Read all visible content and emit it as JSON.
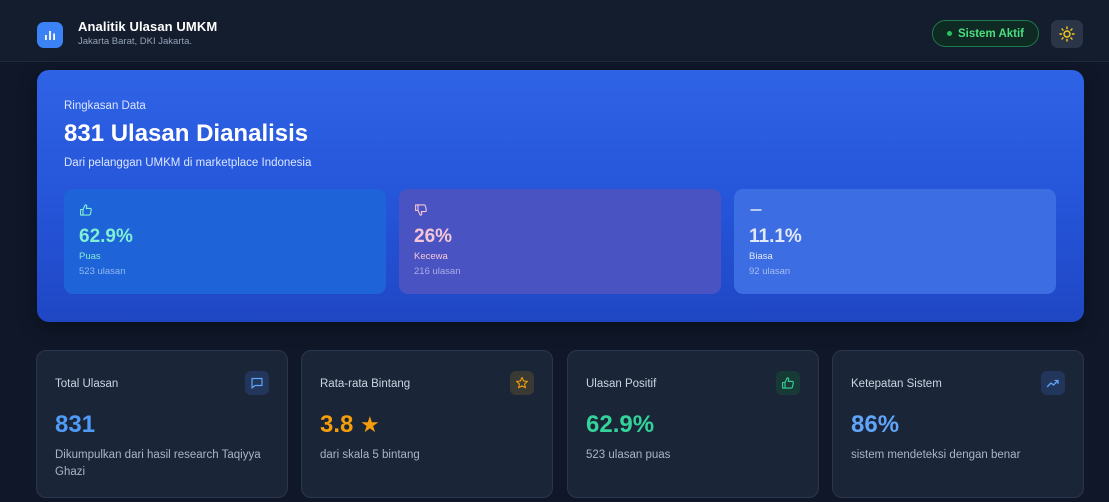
{
  "header": {
    "app_title": "Analitik Ulasan UMKM",
    "location": "Jakarta Barat, DKI Jakarta.",
    "status_label": "Sistem Aktif",
    "logo_icon": "bar-chart-icon",
    "theme_icon": "sun-icon"
  },
  "hero": {
    "kicker": "Ringkasan Data",
    "title": "831 Ulasan Dianalisis",
    "subtitle": "Dari pelanggan UMKM di marketplace Indonesia",
    "stats": [
      {
        "icon": "thumbs-up-icon",
        "value": "62.9%",
        "label": "Puas",
        "count": "523 ulasan"
      },
      {
        "icon": "thumbs-down-icon",
        "value": "26%",
        "label": "Kecewa",
        "count": "216 ulasan"
      },
      {
        "icon": "minus-icon",
        "value": "11.1%",
        "label": "Biasa",
        "count": "92 ulasan"
      }
    ]
  },
  "metrics": [
    {
      "title": "Total Ulasan",
      "icon": "message-square-icon",
      "value": "831",
      "desc": "Dikumpulkan dari hasil research Taqiyya Ghazi"
    },
    {
      "title": "Rata-rata Bintang",
      "icon": "star-icon",
      "value": "3.8",
      "value_suffix": "★",
      "desc": "dari skala 5 bintang"
    },
    {
      "title": "Ulasan Positif",
      "icon": "thumbs-up-icon",
      "value": "62.9%",
      "desc": "523 ulasan puas"
    },
    {
      "title": "Ketepatan Sistem",
      "icon": "trending-up-icon",
      "value": "86%",
      "desc": "sistem mendeteksi dengan benar"
    }
  ],
  "colors": {
    "background": "#0f1729",
    "accent_blue": "#3b82f6",
    "hero_blue": "#2a5ce0",
    "status_green": "#4ade80",
    "star_amber": "#f59e0b",
    "positive_green": "#34d399"
  }
}
